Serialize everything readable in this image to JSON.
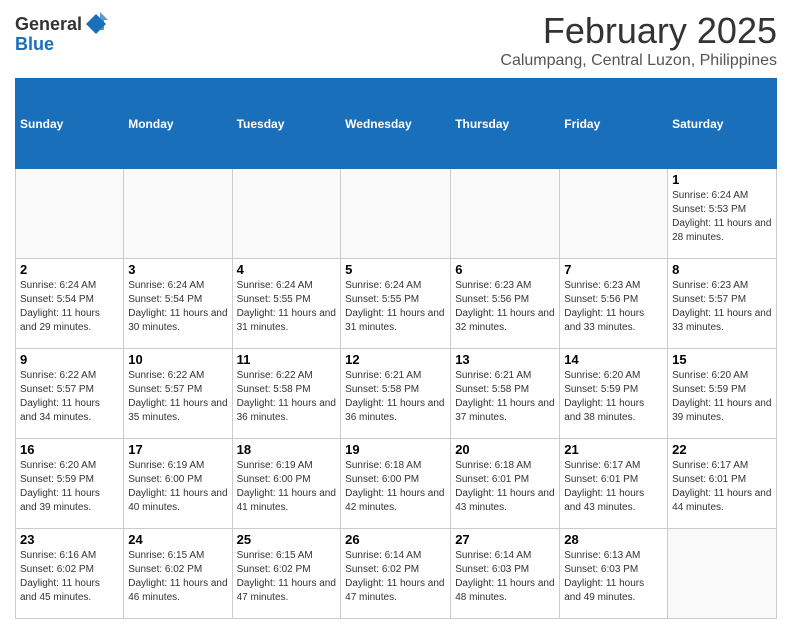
{
  "header": {
    "logo_general": "General",
    "logo_blue": "Blue",
    "month_title": "February 2025",
    "location": "Calumpang, Central Luzon, Philippines"
  },
  "weekdays": [
    "Sunday",
    "Monday",
    "Tuesday",
    "Wednesday",
    "Thursday",
    "Friday",
    "Saturday"
  ],
  "weeks": [
    [
      {
        "day": "",
        "info": ""
      },
      {
        "day": "",
        "info": ""
      },
      {
        "day": "",
        "info": ""
      },
      {
        "day": "",
        "info": ""
      },
      {
        "day": "",
        "info": ""
      },
      {
        "day": "",
        "info": ""
      },
      {
        "day": "1",
        "info": "Sunrise: 6:24 AM\nSunset: 5:53 PM\nDaylight: 11 hours and 28 minutes."
      }
    ],
    [
      {
        "day": "2",
        "info": "Sunrise: 6:24 AM\nSunset: 5:54 PM\nDaylight: 11 hours and 29 minutes."
      },
      {
        "day": "3",
        "info": "Sunrise: 6:24 AM\nSunset: 5:54 PM\nDaylight: 11 hours and 30 minutes."
      },
      {
        "day": "4",
        "info": "Sunrise: 6:24 AM\nSunset: 5:55 PM\nDaylight: 11 hours and 31 minutes."
      },
      {
        "day": "5",
        "info": "Sunrise: 6:24 AM\nSunset: 5:55 PM\nDaylight: 11 hours and 31 minutes."
      },
      {
        "day": "6",
        "info": "Sunrise: 6:23 AM\nSunset: 5:56 PM\nDaylight: 11 hours and 32 minutes."
      },
      {
        "day": "7",
        "info": "Sunrise: 6:23 AM\nSunset: 5:56 PM\nDaylight: 11 hours and 33 minutes."
      },
      {
        "day": "8",
        "info": "Sunrise: 6:23 AM\nSunset: 5:57 PM\nDaylight: 11 hours and 33 minutes."
      }
    ],
    [
      {
        "day": "9",
        "info": "Sunrise: 6:22 AM\nSunset: 5:57 PM\nDaylight: 11 hours and 34 minutes."
      },
      {
        "day": "10",
        "info": "Sunrise: 6:22 AM\nSunset: 5:57 PM\nDaylight: 11 hours and 35 minutes."
      },
      {
        "day": "11",
        "info": "Sunrise: 6:22 AM\nSunset: 5:58 PM\nDaylight: 11 hours and 36 minutes."
      },
      {
        "day": "12",
        "info": "Sunrise: 6:21 AM\nSunset: 5:58 PM\nDaylight: 11 hours and 36 minutes."
      },
      {
        "day": "13",
        "info": "Sunrise: 6:21 AM\nSunset: 5:58 PM\nDaylight: 11 hours and 37 minutes."
      },
      {
        "day": "14",
        "info": "Sunrise: 6:20 AM\nSunset: 5:59 PM\nDaylight: 11 hours and 38 minutes."
      },
      {
        "day": "15",
        "info": "Sunrise: 6:20 AM\nSunset: 5:59 PM\nDaylight: 11 hours and 39 minutes."
      }
    ],
    [
      {
        "day": "16",
        "info": "Sunrise: 6:20 AM\nSunset: 5:59 PM\nDaylight: 11 hours and 39 minutes."
      },
      {
        "day": "17",
        "info": "Sunrise: 6:19 AM\nSunset: 6:00 PM\nDaylight: 11 hours and 40 minutes."
      },
      {
        "day": "18",
        "info": "Sunrise: 6:19 AM\nSunset: 6:00 PM\nDaylight: 11 hours and 41 minutes."
      },
      {
        "day": "19",
        "info": "Sunrise: 6:18 AM\nSunset: 6:00 PM\nDaylight: 11 hours and 42 minutes."
      },
      {
        "day": "20",
        "info": "Sunrise: 6:18 AM\nSunset: 6:01 PM\nDaylight: 11 hours and 43 minutes."
      },
      {
        "day": "21",
        "info": "Sunrise: 6:17 AM\nSunset: 6:01 PM\nDaylight: 11 hours and 43 minutes."
      },
      {
        "day": "22",
        "info": "Sunrise: 6:17 AM\nSunset: 6:01 PM\nDaylight: 11 hours and 44 minutes."
      }
    ],
    [
      {
        "day": "23",
        "info": "Sunrise: 6:16 AM\nSunset: 6:02 PM\nDaylight: 11 hours and 45 minutes."
      },
      {
        "day": "24",
        "info": "Sunrise: 6:15 AM\nSunset: 6:02 PM\nDaylight: 11 hours and 46 minutes."
      },
      {
        "day": "25",
        "info": "Sunrise: 6:15 AM\nSunset: 6:02 PM\nDaylight: 11 hours and 47 minutes."
      },
      {
        "day": "26",
        "info": "Sunrise: 6:14 AM\nSunset: 6:02 PM\nDaylight: 11 hours and 47 minutes."
      },
      {
        "day": "27",
        "info": "Sunrise: 6:14 AM\nSunset: 6:03 PM\nDaylight: 11 hours and 48 minutes."
      },
      {
        "day": "28",
        "info": "Sunrise: 6:13 AM\nSunset: 6:03 PM\nDaylight: 11 hours and 49 minutes."
      },
      {
        "day": "",
        "info": ""
      }
    ]
  ]
}
